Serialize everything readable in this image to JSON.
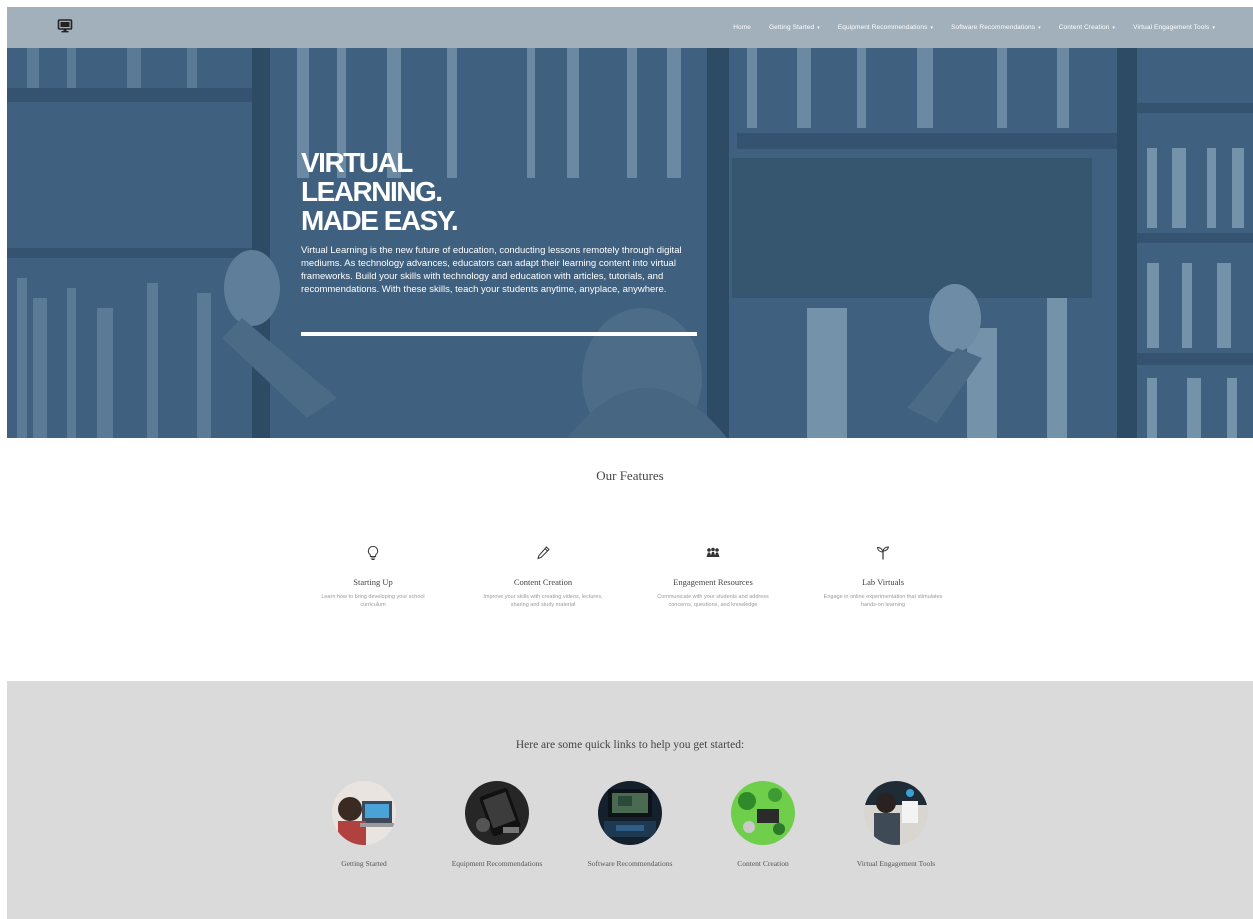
{
  "nav": {
    "logo_icon": "monitor-icon",
    "items": [
      {
        "label": "Home",
        "dropdown": false
      },
      {
        "label": "Getting Started",
        "dropdown": true
      },
      {
        "label": "Equipment Recommendations",
        "dropdown": true
      },
      {
        "label": "Software Recommendations",
        "dropdown": true
      },
      {
        "label": "Content Creation",
        "dropdown": true
      },
      {
        "label": "Virtual Engagement Tools",
        "dropdown": true
      }
    ]
  },
  "hero": {
    "title_lines": [
      "VIRTUAL",
      "LEARNING.",
      "MADE EASY."
    ],
    "description": "Virtual Learning is the new future of education, conducting lessons remotely through digital mediums. As technology advances, educators can adapt their learning content into virtual frameworks. Build your skills with technology and education with articles, tutorials, and recommendations. With these skills, teach your students anytime, anyplace, anywhere."
  },
  "features": {
    "title": "Our Features",
    "items": [
      {
        "icon": "lightbulb-icon",
        "name": "Starting Up",
        "desc": "Learn how to bring developing your school curriculum"
      },
      {
        "icon": "pencil-icon",
        "name": "Content Creation",
        "desc": "Improve your skills with creating videos, lectures, sharing and study material"
      },
      {
        "icon": "group-icon",
        "name": "Engagement Resources",
        "desc": "Communicate with your students and address concerns, questions, and knowledge"
      },
      {
        "icon": "sprout-icon",
        "name": "Lab Virtuals",
        "desc": "Engage in online experimentation that stimulates hands-on learning"
      }
    ]
  },
  "quick_links": {
    "title": "Here are some quick links to help you get started:",
    "items": [
      {
        "label": "Getting Started",
        "image": "student-laptop-photo"
      },
      {
        "label": "Equipment Recommendations",
        "image": "tablet-headphones-photo"
      },
      {
        "label": "Software Recommendations",
        "image": "laptop-screen-photo"
      },
      {
        "label": "Content Creation",
        "image": "green-desk-photo"
      },
      {
        "label": "Virtual Engagement Tools",
        "image": "video-call-photo"
      }
    ]
  },
  "colors": {
    "navbar": "#a2b0bb",
    "hero_overlay": "#3e5f7d",
    "quick_links_bg": "#dadada"
  }
}
